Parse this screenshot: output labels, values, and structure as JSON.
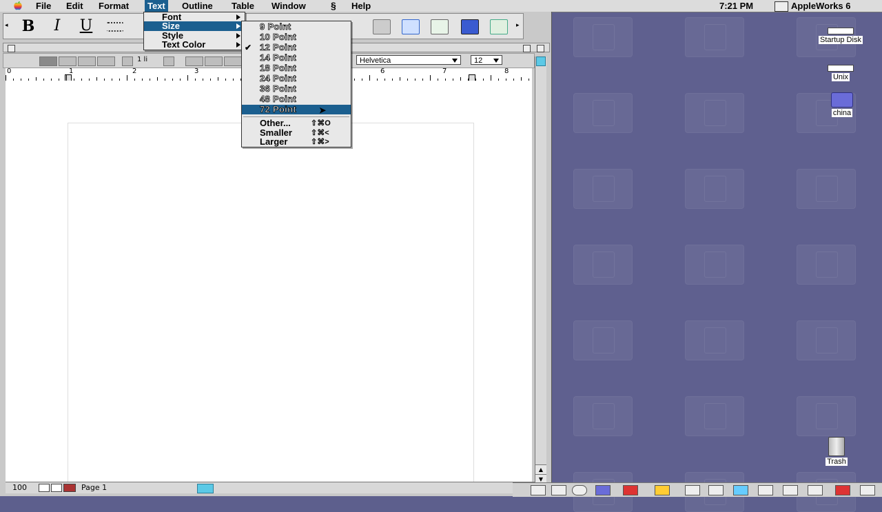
{
  "menubar": {
    "items": [
      "File",
      "Edit",
      "Format",
      "Text",
      "Outline",
      "Table",
      "Window",
      "Help"
    ],
    "active": "Text",
    "clock": "7:21 PM",
    "app_name": "AppleWorks 6"
  },
  "text_menu": {
    "items": [
      "Font",
      "Size",
      "Style",
      "Text Color"
    ],
    "selected": "Size"
  },
  "size_menu": {
    "points": [
      "9 Point",
      "10 Point",
      "12 Point",
      "14 Point",
      "18 Point",
      "24 Point",
      "36 Point",
      "48 Point",
      "72 Point"
    ],
    "checked": "12 Point",
    "highlighted": "72 Point",
    "other": [
      {
        "label": "Other...",
        "shortcut": "⇧⌘O"
      },
      {
        "label": "Smaller",
        "shortcut": "⇧⌘<"
      },
      {
        "label": "Larger",
        "shortcut": "⇧⌘>"
      }
    ]
  },
  "toolbar": {
    "bold": "B",
    "italic": "I",
    "underline": "U"
  },
  "ruler_bar": {
    "line_spacing": "1 li",
    "font": "Helvetica",
    "size": "12"
  },
  "ruler": {
    "numbers": [
      "0",
      "1",
      "2",
      "3",
      "6",
      "7",
      "8"
    ]
  },
  "status": {
    "zoom": "100",
    "page": "Page 1"
  },
  "desktop": {
    "icons": [
      "Startup Disk",
      "Unix",
      "china",
      "Trash"
    ]
  },
  "colors": {
    "desktop": "#5f608f",
    "highlight": "#1b5f8f",
    "scroll_accent": "#5cc9e6"
  }
}
